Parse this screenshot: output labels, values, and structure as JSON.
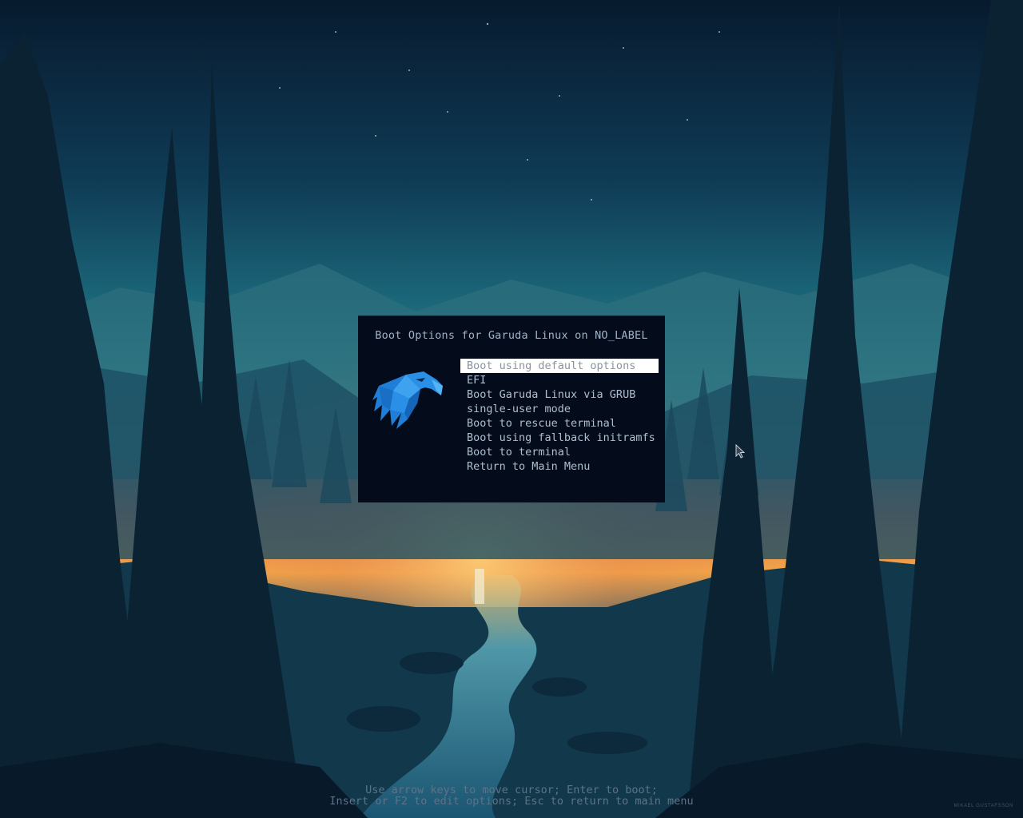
{
  "dialog": {
    "title": "Boot Options for Garuda Linux on NO_LABEL",
    "logo_icon": "garuda-eagle-icon",
    "menu_items": [
      {
        "label": "Boot using default options",
        "selected": true
      },
      {
        "label": "EFI",
        "selected": false
      },
      {
        "label": "Boot Garuda Linux via GRUB",
        "selected": false
      },
      {
        "label": "single-user mode",
        "selected": false
      },
      {
        "label": "Boot to rescue terminal",
        "selected": false
      },
      {
        "label": "Boot using fallback initramfs",
        "selected": false
      },
      {
        "label": "Boot to terminal",
        "selected": false
      },
      {
        "label": "Return to Main Menu",
        "selected": false
      }
    ]
  },
  "help": {
    "line1": "Use arrow keys to move cursor; Enter to boot;",
    "line2": "Insert or F2 to edit options; Esc to return to main menu"
  },
  "wallpaper": {
    "credit": "MIKAEL GUSTAFSSON"
  },
  "colors": {
    "dialog_bg": "#040c1b",
    "text": "#aebfd1",
    "selection_bg": "#ffffff",
    "help_text": "#5d7387",
    "eagle_blue": "#2a8fe6"
  }
}
